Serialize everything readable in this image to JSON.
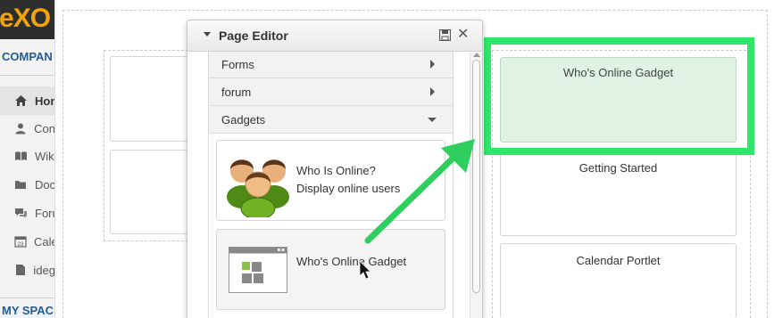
{
  "app": {
    "logo_text_e": "e",
    "logo_text_rest": "XO",
    "brand_color": "#f0a30a"
  },
  "sidebar": {
    "company_label": "COMPAN",
    "items": [
      {
        "label": "Hom",
        "icon": "home-icon",
        "active": true
      },
      {
        "label": "Con",
        "icon": "user-icon",
        "active": false
      },
      {
        "label": "Wiki",
        "icon": "book-icon",
        "active": false
      },
      {
        "label": "Doc",
        "icon": "folder-icon",
        "active": false
      },
      {
        "label": "Foru",
        "icon": "comments-icon",
        "active": false
      },
      {
        "label": "Cale",
        "icon": "calendar-icon",
        "active": false
      },
      {
        "label": "ideg",
        "icon": "file-icon",
        "active": false
      }
    ],
    "myspaces_label": "MY SPAC"
  },
  "editor": {
    "title": "Page Editor",
    "categories": [
      {
        "label": "Forms",
        "expanded": false
      },
      {
        "label": "forum",
        "expanded": false
      },
      {
        "label": "Gadgets",
        "expanded": true
      }
    ],
    "gadgets": [
      {
        "line1": "Who Is Online?",
        "line2": "Display online users",
        "icon": "users-group-icon"
      },
      {
        "line1": "Who's Online Gadget",
        "icon": "gadget-window-icon"
      }
    ]
  },
  "canvas": {
    "drop_target_label": "Who's Online Gadget",
    "portlets": [
      {
        "label": "Getting Started"
      },
      {
        "label": "Calendar Portlet"
      }
    ],
    "highlight_color": "#2ee66a",
    "drop_fill_color": "#dff2e3"
  }
}
